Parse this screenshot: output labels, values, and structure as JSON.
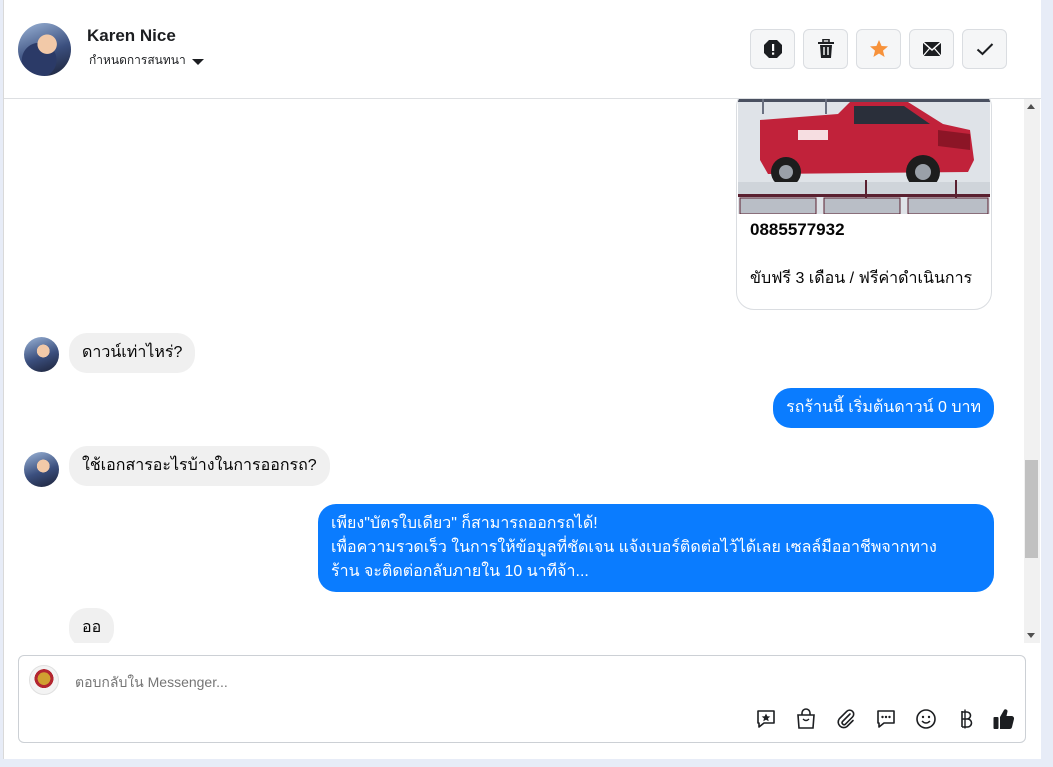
{
  "contact": {
    "name": "Karen Nice",
    "settings_label": "กำหนดการสนทนา"
  },
  "header_actions": [
    "spam-button",
    "delete-button",
    "star-button",
    "mark-unread-button",
    "done-button"
  ],
  "card": {
    "phone": "0885577932",
    "description": "ขับฟรี 3 เดือน / ฟรีค่าดำเนินการ"
  },
  "messages": [
    {
      "from": "contact",
      "text": "ดาวน์เท่าไหร่?"
    },
    {
      "from": "page",
      "text": "รถร้านนี้ เริ่มต้นดาวน์ 0 บาท"
    },
    {
      "from": "contact",
      "text": "ใช้เอกสารอะไรบ้างในการออกรถ?"
    },
    {
      "from": "page",
      "lines": [
        "เพียง\"บัตรใบเดียว\" ก็สามารถออกรถได้!",
        "เพื่อความรวดเร็ว ในการให้ข้อมูลที่ชัดเจน แจ้งเบอร์ติดต่อไว้ได้เลย เซลล์มืออาชีพจากทาง",
        "ร้าน จะติดต่อกลับภายใน 10 นาทีจ้า..."
      ]
    },
    {
      "from": "contact",
      "text": "ออ"
    }
  ],
  "composer": {
    "placeholder": "ตอบกลับใน Messenger..."
  },
  "colors": {
    "accent": "#0a7cff",
    "star": "#f7923b",
    "incoming_bubble": "#f0f0f0"
  }
}
